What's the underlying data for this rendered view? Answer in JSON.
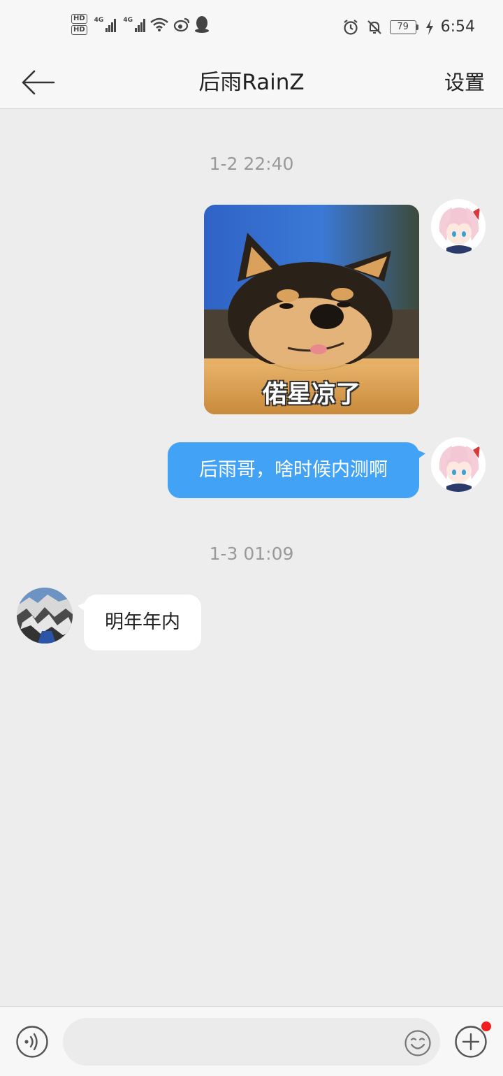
{
  "status_bar": {
    "hd1": "HD",
    "hd2": "HD",
    "net1": "4G",
    "net2": "4G",
    "battery": "79",
    "time": "6:54",
    "icons": [
      "signal-icon",
      "wifi-icon",
      "weibo-icon",
      "qq-icon",
      "alarm-icon",
      "mute-icon",
      "battery-icon",
      "charging-icon"
    ]
  },
  "header": {
    "title": "后雨RainZ",
    "settings_label": "设置"
  },
  "messages": {
    "time1": "1-2 22:40",
    "image_caption": "偌星凉了",
    "outgoing_text": "后雨哥，啥时候内测啊",
    "time2": "1-3 01:09",
    "incoming_text": "明年年内"
  },
  "input_bar": {
    "placeholder": "",
    "has_notification_dot": true
  },
  "colors": {
    "outgoing_bubble": "#41a2f6",
    "background": "#ededed",
    "notification_dot": "#f21e1e"
  }
}
